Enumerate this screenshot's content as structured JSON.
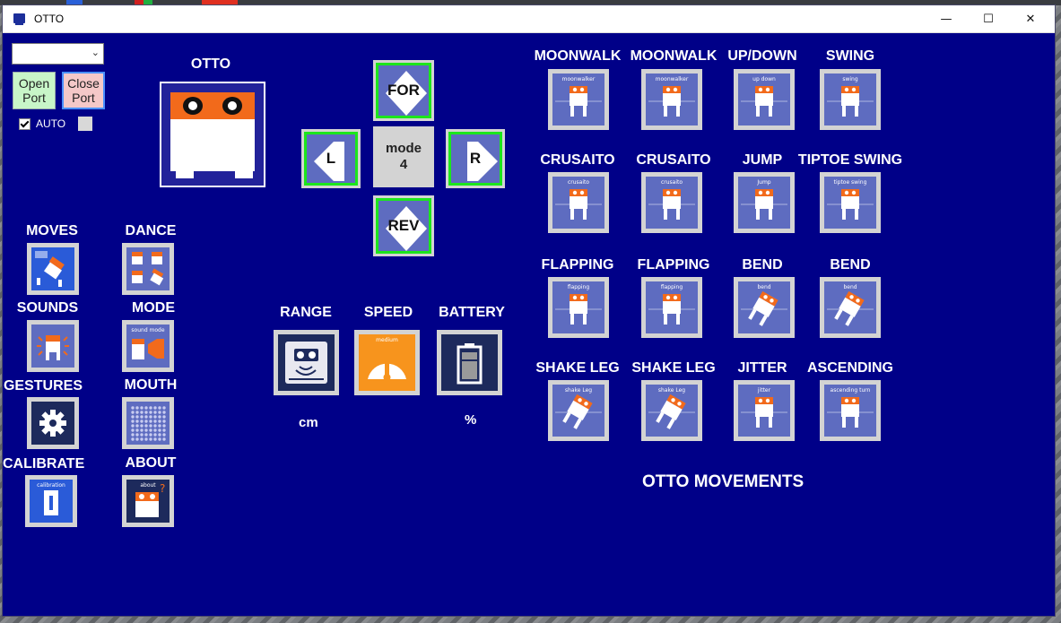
{
  "window": {
    "title": "OTTO",
    "controls": {
      "minimize": "—",
      "maximize": "☐",
      "close": "✕"
    }
  },
  "port": {
    "combo_value": "",
    "combo_arrow": "⌄",
    "open_label_1": "Open",
    "open_label_2": "Port",
    "close_label_1": "Close",
    "close_label_2": "Port",
    "auto_label": "AUTO",
    "auto_checked": true
  },
  "logo_label": "OTTO",
  "left_menu": [
    {
      "label": "MOVES",
      "icon": "moves-icon"
    },
    {
      "label": "DANCE",
      "icon": "dance-icon"
    },
    {
      "label": "SOUNDS",
      "icon": "sounds-icon"
    },
    {
      "label": "MODE",
      "icon": "mode-icon"
    },
    {
      "label": "GESTURES",
      "icon": "gear-icon"
    },
    {
      "label": "MOUTH",
      "icon": "mouth-matrix-icon"
    },
    {
      "label": "CALIBRATE",
      "icon": "calibration-icon"
    },
    {
      "label": "ABOUT",
      "icon": "about-icon"
    }
  ],
  "left_menu_mini": {
    "mode": "sound mode",
    "calibrate": "calibration",
    "about": "about"
  },
  "dpad": {
    "forward": "FOR",
    "left": "L",
    "right": "R",
    "reverse": "REV",
    "mode_line1": "mode",
    "mode_line2": "4"
  },
  "sensors": {
    "range": {
      "label": "RANGE",
      "unit": "cm"
    },
    "speed": {
      "label": "SPEED",
      "level": "medium"
    },
    "battery": {
      "label": "BATTERY",
      "unit": "%"
    }
  },
  "movements": [
    {
      "label": "MOONWALK",
      "mini": "moonwalker"
    },
    {
      "label": "MOONWALK",
      "mini": "moonwalker"
    },
    {
      "label": "UP/DOWN",
      "mini": "up down"
    },
    {
      "label": "SWING",
      "mini": "swing"
    },
    {
      "label": "CRUSAITO",
      "mini": "crusaito"
    },
    {
      "label": "CRUSAITO",
      "mini": "crusaito"
    },
    {
      "label": "JUMP",
      "mini": "Jump"
    },
    {
      "label": "TIPTOE SWING",
      "mini": "tiptoe swing"
    },
    {
      "label": "FLAPPING",
      "mini": "flapping"
    },
    {
      "label": "FLAPPING",
      "mini": "flapping"
    },
    {
      "label": "BEND",
      "mini": "bend"
    },
    {
      "label": "BEND",
      "mini": "bend"
    },
    {
      "label": "SHAKE LEG",
      "mini": "shake Leg"
    },
    {
      "label": "SHAKE LEG",
      "mini": "shake Leg"
    },
    {
      "label": "JITTER",
      "mini": "jitter"
    },
    {
      "label": "ASCENDING",
      "mini": "ascending turn"
    }
  ],
  "footer": "OTTO MOVEMENTS",
  "colors": {
    "window_bg": "#000088",
    "tile_frame": "#d3d3d3",
    "tile_fill": "#5e6cc0",
    "otto_orange": "#f26a1b",
    "dpad_border": "#1ce61c"
  }
}
